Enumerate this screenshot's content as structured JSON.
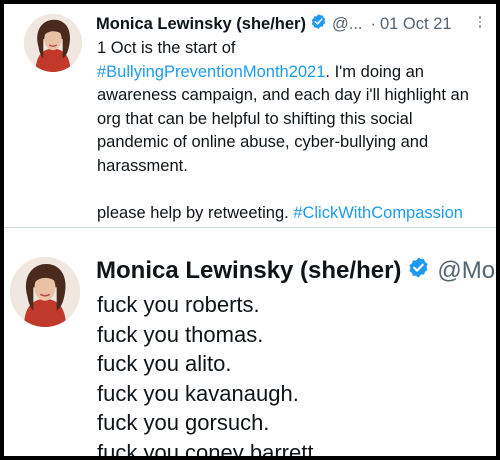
{
  "tweet_1": {
    "author_name": "Monica Lewinsky (she/her)",
    "handle": "@...",
    "separator": "·",
    "date": "01 Oct 21",
    "body_lines": [
      "1 Oct is the start of",
      "awareness campaign, and each day i'll highlight an",
      "org that can be helpful to shifting this social",
      "pandemic of online abuse, cyber-bullying and",
      "harassment."
    ],
    "hashtag_1": "#BullyingPreventionMonth2021",
    "after_hashtag_1": ".  I'm doing an",
    "closing_text": "please help by retweeting. ",
    "hashtag_2": "#ClickWithCompassion",
    "icons": {
      "verified": "verified-badge-icon",
      "more": "more-options-icon"
    },
    "colors": {
      "link": "#1d9bf0",
      "verified": "#1d9bf0",
      "secondary": "#536471"
    }
  },
  "tweet_2": {
    "author_name": "Monica Lewinsky (she/her)",
    "handle": "@Monic",
    "body_lines": [
      "fuck you roberts.",
      "fuck you thomas.",
      "fuck you alito.",
      "fuck you kavanaugh.",
      "fuck you gorsuch.",
      "fuck you coney barrett."
    ]
  }
}
